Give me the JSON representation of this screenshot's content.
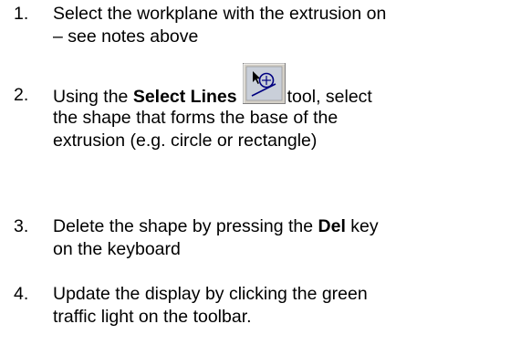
{
  "steps": [
    {
      "number": "1.",
      "lines": [
        "Select the workplane with the extrusion on",
        "– see notes above"
      ]
    },
    {
      "number": "2.",
      "line1_pre": "Using the ",
      "line1_bold": "Select Lines",
      "line1_post": "tool, select",
      "icon": "select-lines-tool-icon",
      "lines_rest": [
        "the shape that forms the base of the",
        "extrusion (e.g. circle or rectangle)"
      ]
    },
    {
      "number": "3.",
      "line1_pre": "Delete the shape by pressing the ",
      "line1_bold": "Del",
      "line1_post": " key",
      "lines_rest": [
        "on the keyboard"
      ]
    },
    {
      "number": "4.",
      "lines": [
        "Update the display by clicking the green",
        "traffic light on the toolbar."
      ]
    }
  ]
}
